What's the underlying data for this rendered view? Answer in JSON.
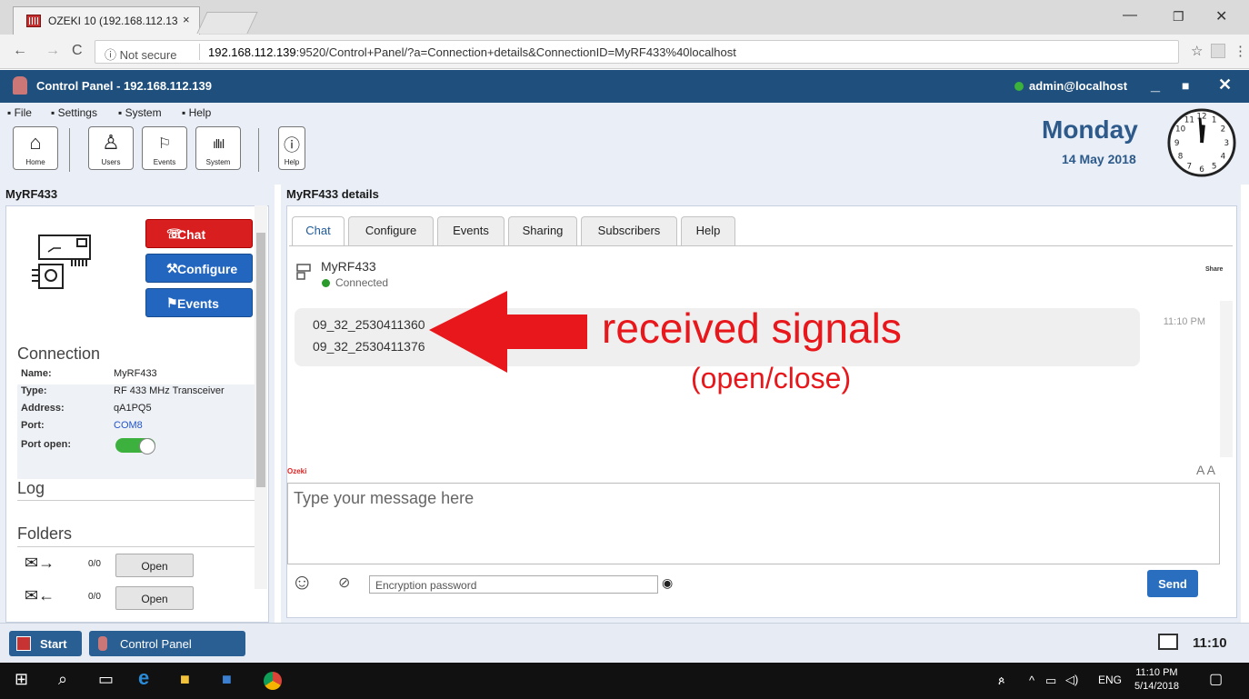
{
  "browser": {
    "tab_title": "OZEKI 10 (192.168.112.13",
    "tab_close": "×",
    "security_label": "ⓘ Not secure",
    "url_host": "192.168.112.139",
    "url_path": ":9520/Control+Panel/?a=Connection+details&ConnectionID=MyRF433%40localhost"
  },
  "app": {
    "title": "Control Panel - 192.168.112.139",
    "user": "admin@localhost",
    "menu": [
      "File",
      "Settings",
      "System",
      "Help"
    ],
    "toolbar": [
      "Home",
      "Users",
      "Events",
      "System",
      "Help"
    ],
    "day": "Monday",
    "date": "14 May 2018"
  },
  "left_panel": {
    "title": "MyRF433",
    "actions": {
      "chat": "Chat",
      "configure": "Configure",
      "events": "Events"
    },
    "connection_heading": "Connection",
    "connection": [
      {
        "key": "Name:",
        "value": "MyRF433"
      },
      {
        "key": "Type:",
        "value": "RF 433 MHz Transceiver"
      },
      {
        "key": "Address:",
        "value": "qA1PQ5"
      },
      {
        "key": "Port:",
        "value": "COM8"
      },
      {
        "key": "Port open:",
        "value": ""
      }
    ],
    "port_open": true,
    "log_heading": "Log",
    "folders_heading": "Folders",
    "folders": [
      {
        "count": "0/0",
        "button": "Open"
      },
      {
        "count": "0/0",
        "button": "Open"
      }
    ]
  },
  "right_panel": {
    "title": "MyRF433 details",
    "tabs": [
      "Chat",
      "Configure",
      "Events",
      "Sharing",
      "Subscribers",
      "Help"
    ],
    "active_tab": "Chat",
    "device_name": "MyRF433",
    "device_status": "Connected",
    "share_label": "Share",
    "messages": [
      "09_32_2530411360",
      "09_32_2530411376"
    ],
    "message_time": "11:10 PM",
    "brand": "Ozeki",
    "font_size_label": "A A",
    "message_placeholder": "Type your message here",
    "password_placeholder": "Encryption password",
    "send": "Send"
  },
  "annotation": {
    "line1": "received signals",
    "line2": "(open/close)",
    "color": "#e8171b"
  },
  "app_taskbar": {
    "start": "Start",
    "control_panel": "Control Panel",
    "time": "11:10"
  },
  "os_taskbar": {
    "lang": "ENG",
    "time": "11:10 PM",
    "date": "5/14/2018"
  }
}
